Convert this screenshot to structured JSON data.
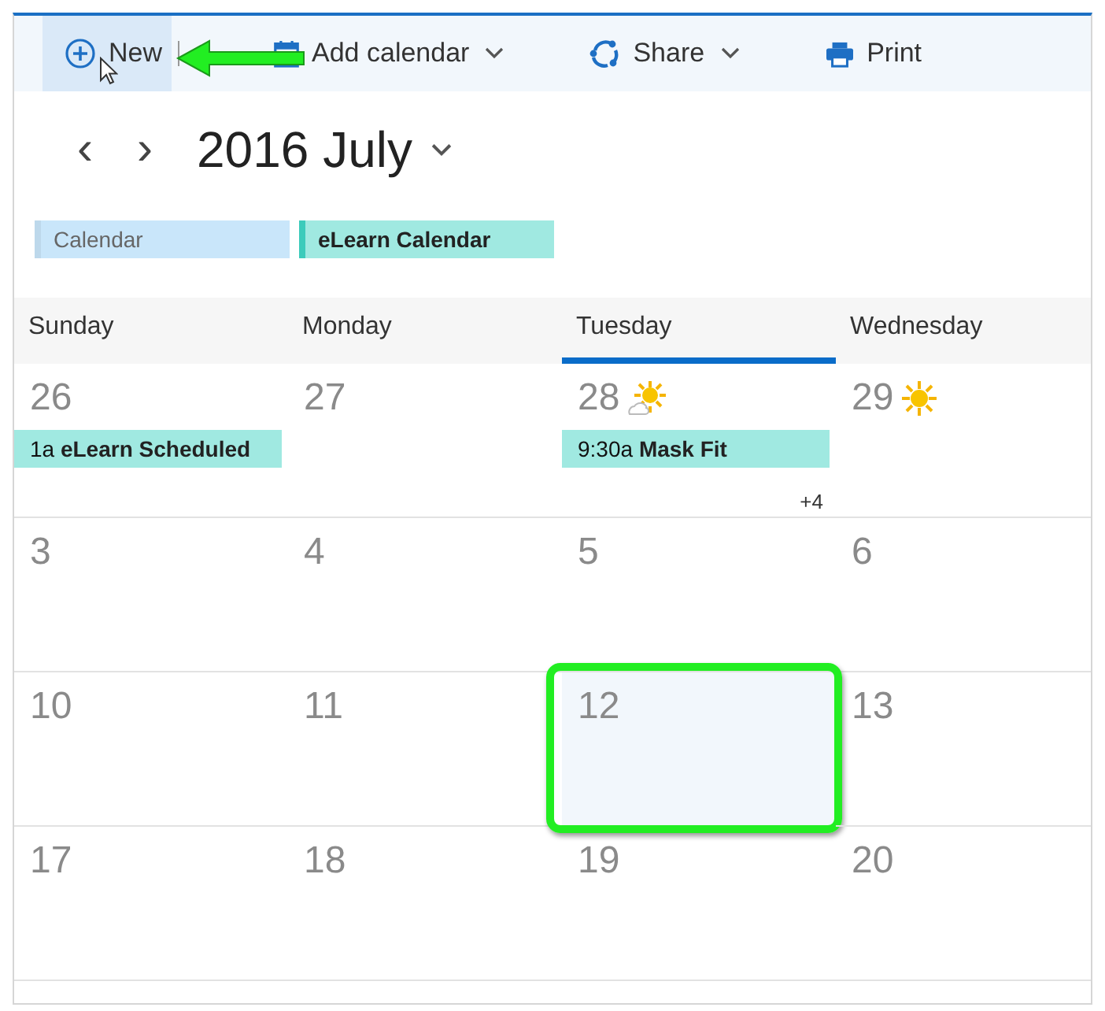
{
  "toolbar": {
    "items": [
      {
        "kind": "new",
        "label": "New",
        "hovered": true,
        "dropdown": false
      },
      {
        "kind": "add-calendar",
        "label": "Add calendar",
        "hovered": false,
        "dropdown": true
      },
      {
        "kind": "share",
        "label": "Share",
        "hovered": false,
        "dropdown": true
      },
      {
        "kind": "print",
        "label": "Print",
        "hovered": false,
        "dropdown": false
      }
    ]
  },
  "navigation": {
    "previous": "‹",
    "next": "›",
    "title": "2016 July"
  },
  "calendars": [
    {
      "label": "Calendar",
      "selected": false,
      "color": "#c9e6fa"
    },
    {
      "label": "eLearn Calendar",
      "selected": true,
      "color": "#a0e9e1"
    }
  ],
  "days": [
    {
      "label": "Sunday",
      "selected": false
    },
    {
      "label": "Monday",
      "selected": false
    },
    {
      "label": "Tuesday",
      "selected": true
    },
    {
      "label": "Wednesday",
      "selected": false
    }
  ],
  "weeks": [
    [
      {
        "date": "26",
        "events": [
          {
            "time": "1a",
            "title": "eLearn Scheduled"
          }
        ],
        "highlighted": false
      },
      {
        "date": "27",
        "highlighted": false
      },
      {
        "date": "28",
        "weather": {
          "kind": "partly-sunny"
        },
        "events": [
          {
            "time": "9:30a",
            "title": "Mask Fit"
          }
        ],
        "more": "+4",
        "highlighted": false
      },
      {
        "date": "29",
        "weather": {
          "kind": "sunny"
        },
        "highlighted": false
      }
    ],
    [
      {
        "date": "3",
        "highlighted": false
      },
      {
        "date": "4",
        "highlighted": false
      },
      {
        "date": "5",
        "highlighted": false
      },
      {
        "date": "6",
        "highlighted": false
      }
    ],
    [
      {
        "date": "10",
        "highlighted": false
      },
      {
        "date": "11",
        "highlighted": false
      },
      {
        "date": "12",
        "highlighted": true
      },
      {
        "date": "13",
        "highlighted": false
      }
    ],
    [
      {
        "date": "17",
        "highlighted": false
      },
      {
        "date": "18",
        "highlighted": false
      },
      {
        "date": "19",
        "highlighted": false
      },
      {
        "date": "20",
        "highlighted": false
      }
    ]
  ],
  "annotation_arrow": true
}
